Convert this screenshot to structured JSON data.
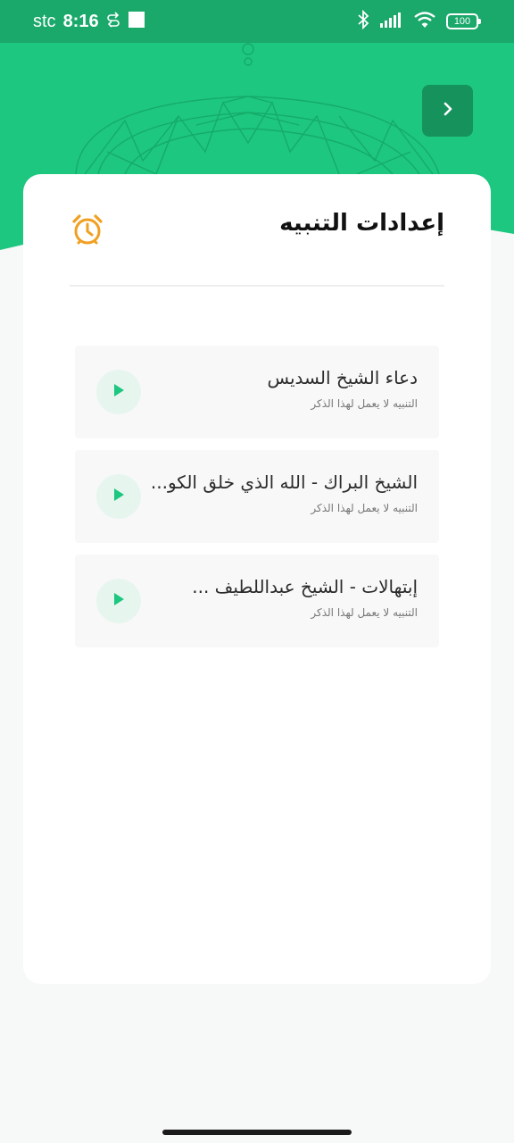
{
  "status_bar": {
    "carrier": "stc",
    "time": "8:16",
    "battery": "100"
  },
  "icons": {
    "back": "chevron-right-icon",
    "alarm": "alarm-clock-icon",
    "play": "play-icon"
  },
  "colors": {
    "header_green": "#1dc77f",
    "status_green": "#1aa86b",
    "back_button": "#16925d",
    "alarm_orange": "#f0a021",
    "play_green": "#1dc77f"
  },
  "alarm_settings": {
    "title": "إعدادات التنبيه",
    "sounds": [
      {
        "title": "دعاء الشيخ السديس",
        "status": "التنبيه لا يعمل لهذا الذكر"
      },
      {
        "title": "الشيخ البراك - الله الذي خلق الكو...",
        "status": "التنبيه لا يعمل لهذا الذكر"
      },
      {
        "title": "إبتهالات - الشيخ عبداللطيف ...",
        "status": "التنبيه لا يعمل لهذا الذكر"
      }
    ]
  }
}
